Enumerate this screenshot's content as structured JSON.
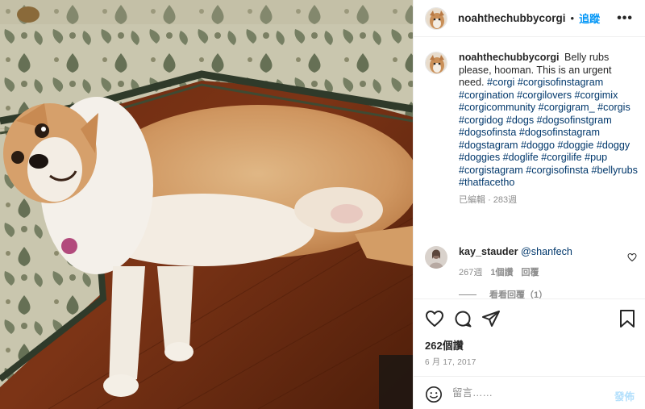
{
  "post": {
    "username": "noahthechubbycorgi",
    "dot": "•",
    "follow_label": "追蹤",
    "more_label": "•••"
  },
  "caption": {
    "username": "noahthechubbycorgi",
    "text": "Belly rubs please, hooman. This is an urgent need.",
    "hashtags": "#corgi #corgisofinstagram #corgination #corgilovers #corgimix #corgicommunity #corgigram_ #corgis #corgidog #dogs #dogsofinstgram #dogsofinsta #dogsofinstagram #dogstagram #doggo #doggie #doggy #doggies #doglife #corgilife #pup #corgistagram #corgisofinsta #bellyrubs #thatfacetho",
    "edited": "已編輯",
    "age": "283週"
  },
  "comment": {
    "username": "kay_stauder",
    "mention": "@shanfech",
    "age": "267週",
    "likes": "1個讚",
    "reply_label": "回覆",
    "view_replies": "看看回覆（1）"
  },
  "actions": {
    "like_icon": "heart-icon",
    "comment_icon": "comment-icon",
    "share_icon": "share-icon",
    "save_icon": "bookmark-icon"
  },
  "stats": {
    "views": "262個讚",
    "date": "6 月 17, 2017"
  },
  "comment_box": {
    "placeholder": "留言……",
    "post_label": "發佈"
  },
  "colors": {
    "link": "#0095f6",
    "hashtag": "#00376b",
    "muted": "#8e8e8e"
  }
}
